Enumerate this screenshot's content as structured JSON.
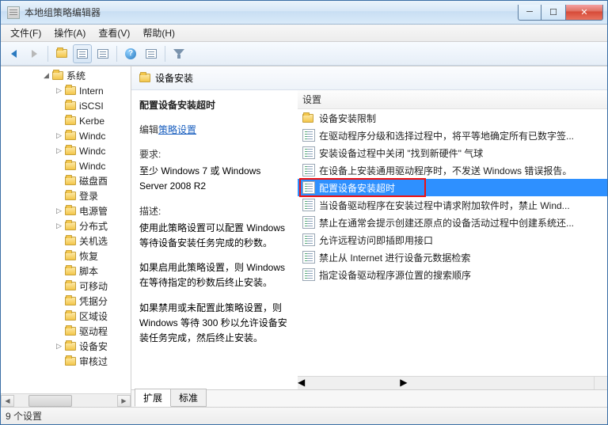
{
  "window": {
    "title": "本地组策略编辑器"
  },
  "menu": {
    "file": "文件(F)",
    "action": "操作(A)",
    "view": "查看(V)",
    "help": "帮助(H)"
  },
  "tree": {
    "root": "系统",
    "items": [
      {
        "label": "Intern",
        "exp": "▷"
      },
      {
        "label": "iSCSI",
        "exp": ""
      },
      {
        "label": "Kerbe",
        "exp": ""
      },
      {
        "label": "Windc",
        "exp": "▷"
      },
      {
        "label": "Windc",
        "exp": "▷"
      },
      {
        "label": "Windc",
        "exp": ""
      },
      {
        "label": "磁盘酉",
        "exp": ""
      },
      {
        "label": "登录",
        "exp": ""
      },
      {
        "label": "电源管",
        "exp": "▷"
      },
      {
        "label": "分布式",
        "exp": "▷"
      },
      {
        "label": "关机选",
        "exp": ""
      },
      {
        "label": "恢复",
        "exp": ""
      },
      {
        "label": "脚本",
        "exp": ""
      },
      {
        "label": "可移动",
        "exp": ""
      },
      {
        "label": "凭据分",
        "exp": ""
      },
      {
        "label": "区域设",
        "exp": ""
      },
      {
        "label": "驱动程",
        "exp": ""
      },
      {
        "label": "设备安",
        "exp": "▷"
      },
      {
        "label": "审核过",
        "exp": ""
      }
    ]
  },
  "header": {
    "title": "设备安装"
  },
  "desc": {
    "title": "配置设备安装超时",
    "edit_label": "编辑",
    "edit_link": "策略设置",
    "req_label": "要求:",
    "req_text": "至少 Windows 7 或 Windows Server 2008 R2",
    "desc_label": "描述:",
    "p1": "使用此策略设置可以配置 Windows 等待设备安装任务完成的秒数。",
    "p2": "如果启用此策略设置，则 Windows 在等待指定的秒数后终止安装。",
    "p3": "如果禁用或未配置此策略设置，则 Windows 等待 300 秒以允许设备安装任务完成，然后终止安装。"
  },
  "list": {
    "column": "设置",
    "items": [
      {
        "type": "folder",
        "label": "设备安装限制"
      },
      {
        "type": "policy",
        "label": "在驱动程序分级和选择过程中，将平等地确定所有已数字签..."
      },
      {
        "type": "policy",
        "label": "安装设备过程中关闭 \"找到新硬件\" 气球"
      },
      {
        "type": "policy",
        "label": "在设备上安装通用驱动程序时，不发送 Windows 错误报告。"
      },
      {
        "type": "policy",
        "label": "配置设备安装超时",
        "selected": true
      },
      {
        "type": "policy",
        "label": "当设备驱动程序在安装过程中请求附加软件时，禁止 Wind..."
      },
      {
        "type": "policy",
        "label": "禁止在通常会提示创建还原点的设备活动过程中创建系统还..."
      },
      {
        "type": "policy",
        "label": "允许远程访问即插即用接口"
      },
      {
        "type": "policy",
        "label": "禁止从 Internet 进行设备元数据检索"
      },
      {
        "type": "policy",
        "label": "指定设备驱动程序源位置的搜索顺序"
      }
    ]
  },
  "tabs": {
    "extended": "扩展",
    "standard": "标准"
  },
  "status": "9 个设置"
}
